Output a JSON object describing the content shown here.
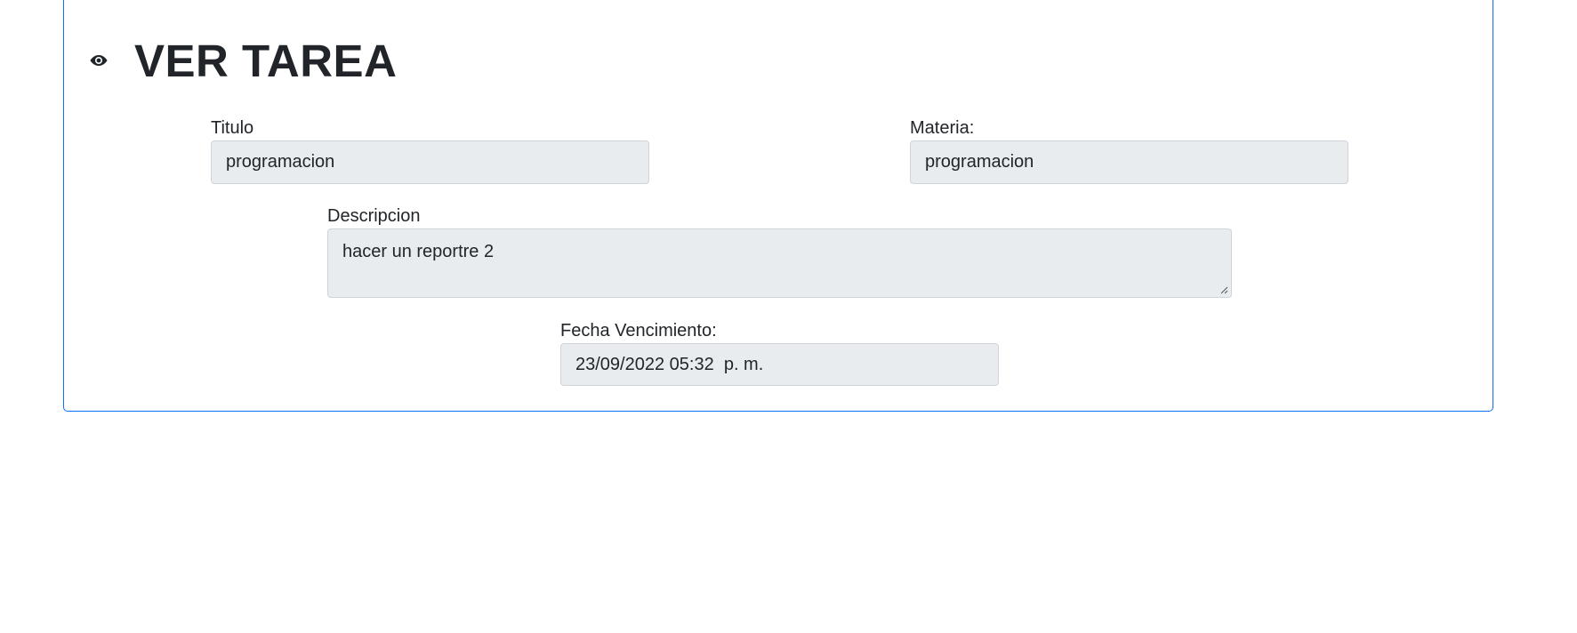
{
  "page": {
    "title": "VER TAREA",
    "title_icon": "eye-icon"
  },
  "form": {
    "titulo": {
      "label": "Titulo",
      "value": "programacion"
    },
    "materia": {
      "label": "Materia:",
      "value": "programacion"
    },
    "descripcion": {
      "label": "Descripcion",
      "value": "hacer un reportre 2"
    },
    "fecha_vencimiento": {
      "label": "Fecha Vencimiento:",
      "value": "23/09/2022 05:32  p. m."
    }
  }
}
